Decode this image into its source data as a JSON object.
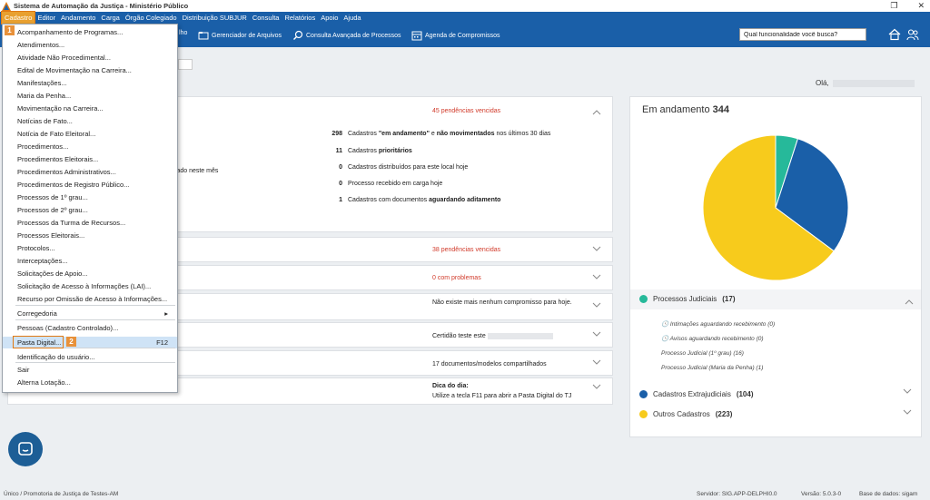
{
  "window": {
    "title": "Sistema de Automação da Justiça - Ministério Público"
  },
  "menu": [
    "Cadastro",
    "Editor",
    "Andamento",
    "Carga",
    "Órgão Colegiado",
    "Distribuição SUBJUR",
    "Consulta",
    "Relatórios",
    "Apoio",
    "Ajuda"
  ],
  "toolbar": {
    "partial": "lho",
    "files": "Gerenciador de Arquivos",
    "advanced": "Consulta Avançada de Processos",
    "agenda": "Agenda de Compromissos"
  },
  "search": {
    "value": "Qual funcionalidade você busca?"
  },
  "greeting": "Olá,",
  "dropdown": {
    "items": [
      "Acompanhamento de Programas...",
      "Atendimentos...",
      "Atividade Não Procedimental...",
      "Edital de Movimentação na Carreira...",
      "Manifestações...",
      "Maria da Penha...",
      "Movimentação na Carreira...",
      "Notícias de Fato...",
      "Notícia de Fato Eleitoral...",
      "Procedimentos...",
      "Procedimentos Eleitorais...",
      "Procedimentos Administrativos...",
      "Procedimentos de Registro Público...",
      "Processos de 1º grau...",
      "Processos de 2º grau...",
      "Processos da Turma de Recursos...",
      "Processos Eleitorais...",
      "Protocolos...",
      "Interceptações...",
      "Solicitações de Apoio...",
      "Solicitação de Acesso à Informações (LAI)...",
      "Recurso por Omissão de Acesso à Informações...",
      "Corregedoria",
      "Pessoas (Cadastro Controlado)...",
      "Pasta Digital...",
      "Identificação do usuário...",
      "Sair",
      "Alterna Lotação..."
    ],
    "shortcut": "F12",
    "badge1": "1",
    "badge2": "2"
  },
  "panels": {
    "p1_pend": "45 pendências vencidas",
    "p2_pend": "38 pendências vencidas",
    "p3_pend": "0 com problemas",
    "p4_text": "Não existe mais nenhum compromisso para hoje.",
    "p5_text": "Certidão teste este",
    "p6_text": "17 documentos/modelos compartilhados",
    "tip_title": "Dica do dia:",
    "tip_text": "Utilize a tecla F11 para abrir a Pasta Digital do TJ",
    "left_fragment": "giado neste mês"
  },
  "stats": [
    {
      "num": "298",
      "pre": "Cadastros ",
      "b1": "\"em andamento\"",
      "mid": " e ",
      "b2": "não movimentados",
      "post": " nos últimos 30 dias"
    },
    {
      "num": "11",
      "pre": "Cadastros ",
      "b1": "prioritários",
      "mid": "",
      "b2": "",
      "post": ""
    },
    {
      "num": "0",
      "pre": "Cadastros distribuídos para este local hoje",
      "b1": "",
      "mid": "",
      "b2": "",
      "post": ""
    },
    {
      "num": "0",
      "pre": "Processo recebido em carga hoje",
      "b1": "",
      "mid": "",
      "b2": "",
      "post": ""
    },
    {
      "num": "1",
      "pre": "Cadastros com documentos ",
      "b1": "aguardando aditamento",
      "mid": "",
      "b2": "",
      "post": ""
    }
  ],
  "right": {
    "title": "Em andamento",
    "count": "344",
    "sections": {
      "judicial": {
        "label": "Processos Judiciais",
        "count": "(17)",
        "color": "#26b99a"
      },
      "extra": {
        "label": "Cadastros Extrajudiciais",
        "count": "(104)",
        "color": "#1a5fa8"
      },
      "other": {
        "label": "Outros Cadastros",
        "count": "(223)",
        "color": "#f7cb1c"
      }
    },
    "sublines": [
      "Intimações aguardando recebimento (0)",
      "Avisos aguardando recebimento (0)",
      "Processo Judicial (1º grau) (16)",
      "Processo Judicial (Maria da Penha) (1)"
    ]
  },
  "chart_data": {
    "type": "pie",
    "categories": [
      "Processos Judiciais",
      "Cadastros Extrajudiciais",
      "Outros Cadastros"
    ],
    "values": [
      17,
      104,
      223
    ],
    "colors": [
      "#26b99a",
      "#1a5fa8",
      "#f7cb1c"
    ]
  },
  "status": {
    "left": "Único / Promotoria de Justiça de Testes-AM",
    "server": "Servidor: SIG.APP-DELPHI0.0",
    "version": "Versão: 5.0.3-0",
    "db": "Base de dados: sigam"
  }
}
